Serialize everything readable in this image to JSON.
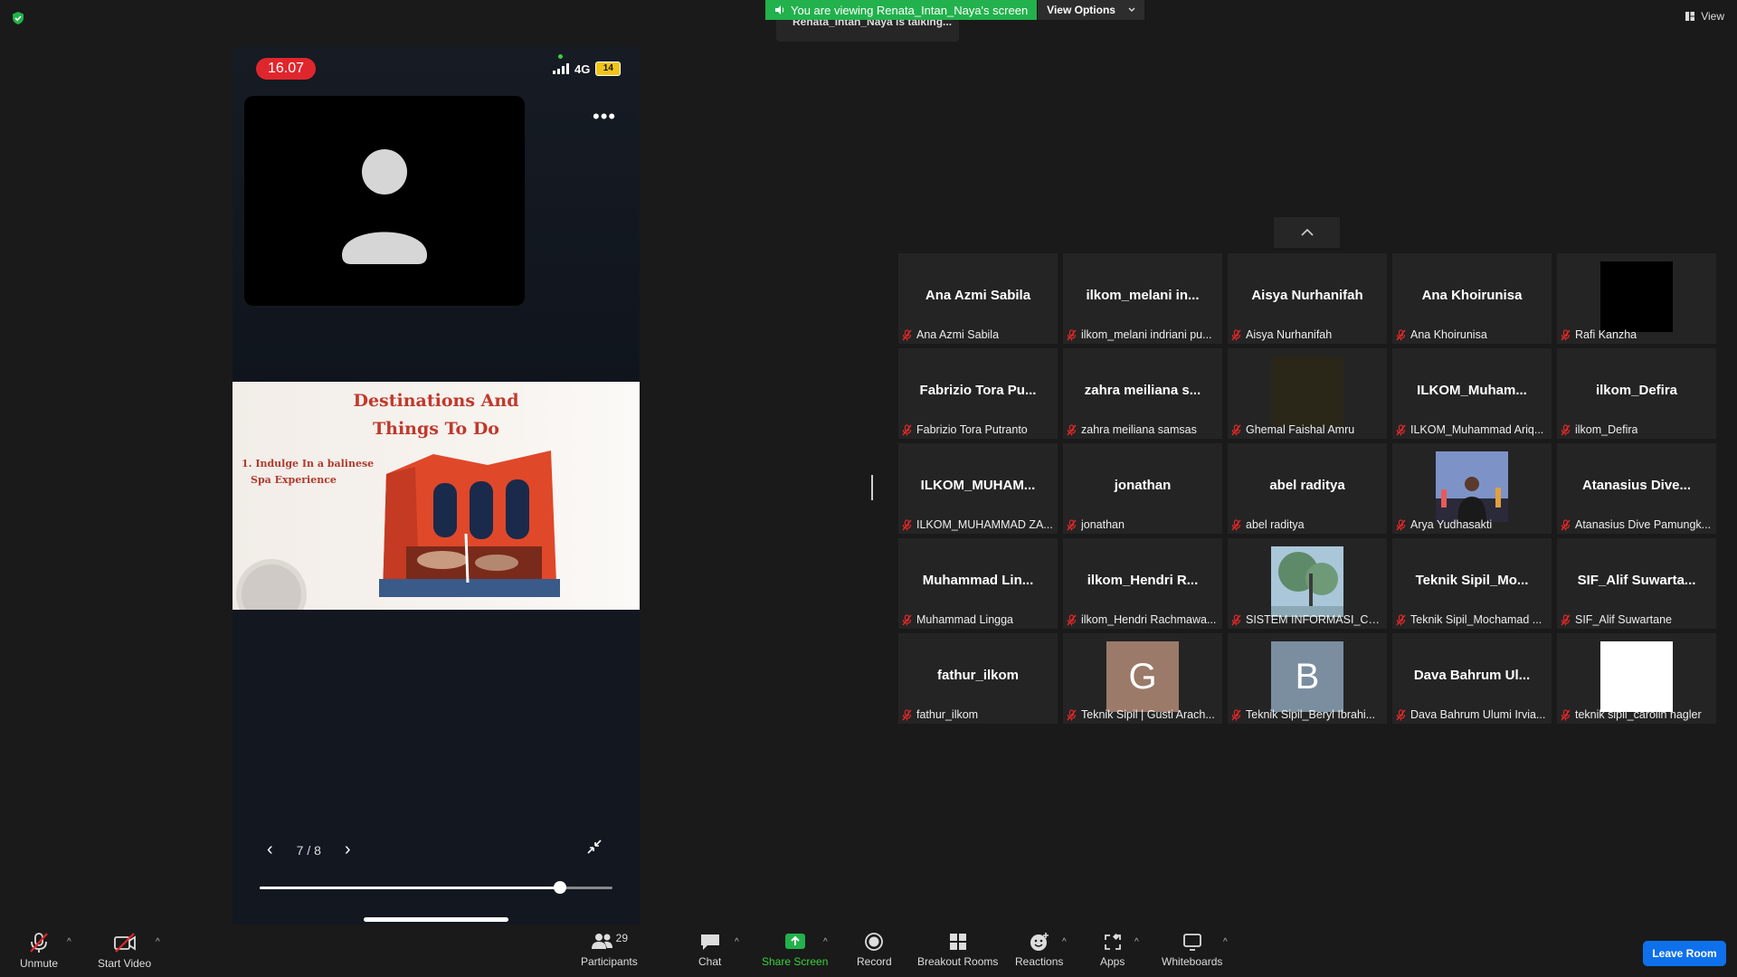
{
  "banner": {
    "viewing": "You are viewing Renata_Intan_Naya's screen",
    "view_options": "View Options",
    "talking": "Renata_Intan_Naya is talking..."
  },
  "view_button": "View",
  "phone": {
    "time": "16.07",
    "network": "4G",
    "battery": "14",
    "slide_title_1": "Destinations And",
    "slide_title_2": "Things To Do",
    "slide_item_1": "1. Indulge In a balinese",
    "slide_item_2": "Spa Experience",
    "page": "7 / 8",
    "progress_fraction": 0.85
  },
  "participants": [
    {
      "big": "Ana Azmi Sabila",
      "name": "Ana Azmi Sabila",
      "type": "text"
    },
    {
      "big": "ilkom_melani  in...",
      "name": "ilkom_melani indriani pu...",
      "type": "text"
    },
    {
      "big": "Aisya Nurhanifah",
      "name": "Aisya Nurhanifah",
      "type": "text"
    },
    {
      "big": "Ana Khoirunisa",
      "name": "Ana Khoirunisa",
      "type": "text"
    },
    {
      "big": "",
      "name": "Rafi Kanzha",
      "type": "black"
    },
    {
      "big": "Fabrizio Tora Pu...",
      "name": "Fabrizio Tora Putranto",
      "type": "text"
    },
    {
      "big": "zahra  meiliana  s...",
      "name": "zahra meiliana samsas",
      "type": "text"
    },
    {
      "big": "",
      "name": "Ghemal Faishal Amru",
      "type": "dim"
    },
    {
      "big": "ILKOM_Muham...",
      "name": "ILKOM_Muhammad Ariq...",
      "type": "text"
    },
    {
      "big": "ilkom_Defira",
      "name": "ilkom_Defira",
      "type": "text"
    },
    {
      "big": "ILKOM_MUHAM...",
      "name": "ILKOM_MUHAMMAD ZA...",
      "type": "text"
    },
    {
      "big": "jonathan",
      "name": "jonathan",
      "type": "text"
    },
    {
      "big": "abel raditya",
      "name": "abel raditya",
      "type": "text"
    },
    {
      "big": "",
      "name": "Arya Yudhasakti",
      "type": "photo-person"
    },
    {
      "big": "Atanasius  Dive...",
      "name": "Atanasius Dive Pamungk...",
      "type": "text"
    },
    {
      "big": "Muhammad  Lin...",
      "name": "Muhammad Lingga",
      "type": "text"
    },
    {
      "big": "ilkom_Hendri  R...",
      "name": "ilkom_Hendri Rachmawa...",
      "type": "text"
    },
    {
      "big": "",
      "name": "SISTEM INFORMASI_CAS...",
      "type": "photo-tree"
    },
    {
      "big": "Teknik  Sipil_Mo...",
      "name": "Teknik Sipil_Mochamad ...",
      "type": "text"
    },
    {
      "big": "SIF_Alif  Suwarta...",
      "name": "SIF_Alif Suwartane",
      "type": "text"
    },
    {
      "big": "fathur_ilkom",
      "name": "fathur_ilkom",
      "type": "text"
    },
    {
      "big": "G",
      "name": "Teknik Sipil | Gusti Arach...",
      "type": "letter-g"
    },
    {
      "big": "B",
      "name": "Teknik Sipil_Beryl Ibrahi...",
      "type": "letter-b"
    },
    {
      "big": "Dava  Bahrum  Ul...",
      "name": "Dava Bahrum Ulumi Irvia...",
      "type": "text"
    },
    {
      "big": "",
      "name": "teknik sipil_carolin nagler",
      "type": "white"
    }
  ],
  "toolbar": {
    "unmute": "Unmute",
    "start_video": "Start Video",
    "participants": "Participants",
    "participants_count": "29",
    "chat": "Chat",
    "share_screen": "Share Screen",
    "record": "Record",
    "breakout": "Breakout Rooms",
    "reactions": "Reactions",
    "apps": "Apps",
    "whiteboards": "Whiteboards",
    "leave": "Leave Room"
  }
}
